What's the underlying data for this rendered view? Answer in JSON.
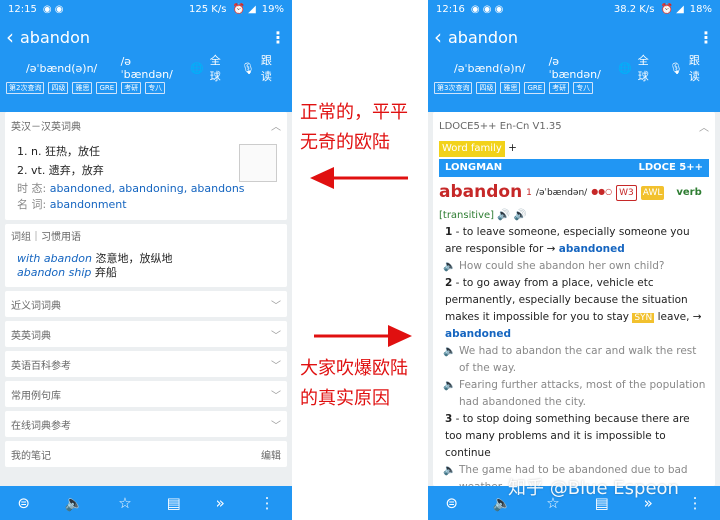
{
  "left": {
    "status": {
      "time": "12:15",
      "speed": "125 K/s",
      "battery": "19%"
    },
    "title": "abandon",
    "phon_uk": "/əˈbænd(ə)n/",
    "phon_us": "/əˈbændən/",
    "global": "全球",
    "follow": "跟读",
    "tags": [
      "第2次查询",
      "四级",
      "雅思",
      "GRE",
      "考研",
      "专八"
    ],
    "hanying": {
      "title": "英汉－汉英词典",
      "defs": [
        "1. n. 狂热，放任",
        "2. vt. 遗弃，放弃"
      ],
      "tense_label": "时 态:",
      "tense_value": "abandoned, abandoning, abandons",
      "noun_label": "名 词:",
      "noun_value": "abandonment"
    },
    "phrases": {
      "title": "词组｜习惯用语",
      "items": [
        {
          "en": "with abandon",
          "zh": "恣意地，放纵地"
        },
        {
          "en": "abandon ship",
          "zh": "弃船"
        }
      ]
    },
    "sections": [
      "近义词词典",
      "英英词典",
      "英语百科参考",
      "常用例句库",
      "在线词典参考"
    ],
    "notes": {
      "title": "我的笔记",
      "edit": "编辑"
    }
  },
  "right": {
    "status": {
      "time": "12:16",
      "speed": "38.2 K/s",
      "battery": "18%"
    },
    "title": "abandon",
    "phon_uk": "/əˈbænd(ə)n/",
    "phon_us": "/əˈbændən/",
    "global": "全球",
    "follow": "跟读",
    "tags": [
      "第3次查询",
      "四级",
      "雅思",
      "GRE",
      "考研",
      "专八"
    ],
    "ld": {
      "title": "LDOCE5++ En-Cn V1.35",
      "word_family": "Word family",
      "plus": "+",
      "longman": "LONGMAN",
      "edition": "LDOCE 5++",
      "headword": "abandon",
      "sup": "1",
      "pron": "/əˈbændən/",
      "dots": "●●○",
      "w3": "W3",
      "awl": "AWL",
      "pos": "verb",
      "gram": "[transitive]",
      "s1_num": "1",
      "s1_def": "to leave someone, especially someone you are responsible for → ",
      "s1_link": "abandoned",
      "s1_ex": "How could she abandon her own child?",
      "s2_num": "2",
      "s2_def": "to go away from a place, vehicle etc permanently, especially because the situation makes it impossible for you to stay ",
      "s2_syn": "SYN",
      "s2_leave": "leave, →",
      "s2_link": "abandoned",
      "s2_ex1": "We had to abandon the car and walk the rest of the way.",
      "s2_ex2": "Fearing further attacks, most of the population had abandoned the city.",
      "s3_num": "3",
      "s3_def": "to stop doing something because there are too many problems and it is impossible to continue",
      "s3_ex": "The game had to be abandoned due to bad weather."
    }
  },
  "annot": {
    "top": [
      "正常的，平平",
      "无奇的欧陆"
    ],
    "bottom": [
      "大家吹爆欧陆",
      "的真实原因"
    ]
  },
  "watermark": "知乎 @Blue Espeon",
  "colors": {
    "primary": "#2196f3",
    "arrow": "#e01010"
  }
}
